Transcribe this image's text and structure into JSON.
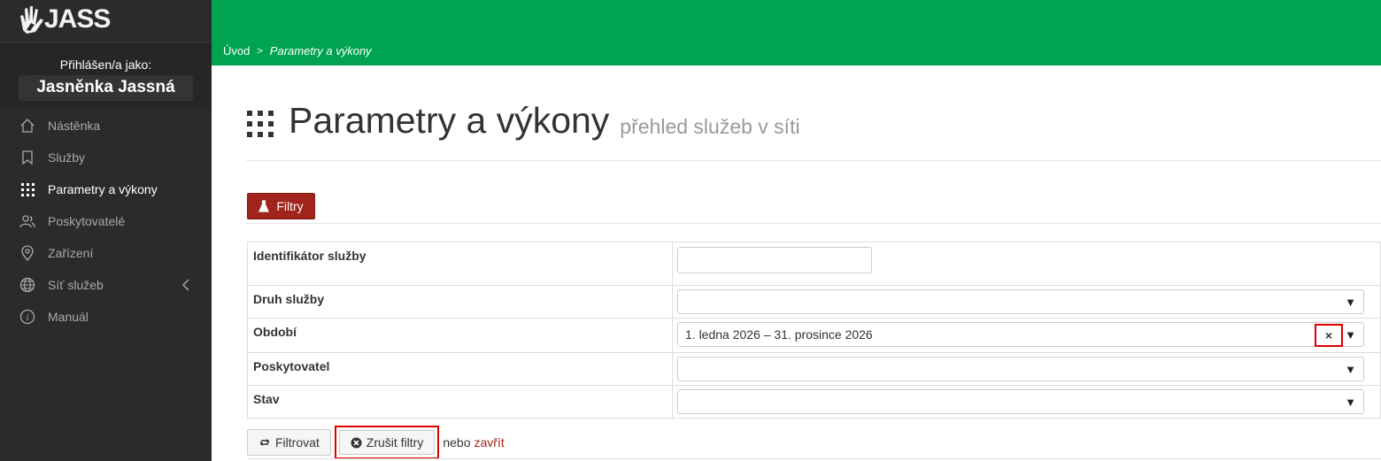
{
  "app": {
    "logo_text": "JASS"
  },
  "user": {
    "label": "Přihlášen/a jako:",
    "name": "Jasněnka Jassná"
  },
  "sidebar": {
    "items": [
      {
        "label": "Nástěnka",
        "icon": "home-icon"
      },
      {
        "label": "Služby",
        "icon": "bookmark-icon"
      },
      {
        "label": "Parametry a výkony",
        "icon": "grid-icon"
      },
      {
        "label": "Poskytovatelé",
        "icon": "users-icon"
      },
      {
        "label": "Zařízení",
        "icon": "map-pin-icon"
      },
      {
        "label": "Síť služeb",
        "icon": "globe-icon"
      },
      {
        "label": "Manuál",
        "icon": "info-icon"
      }
    ]
  },
  "breadcrumb": {
    "home": "Úvod",
    "separator": ">",
    "current": "Parametry a výkony"
  },
  "page": {
    "title": "Parametry a výkony",
    "subtitle": "přehled služeb v síti"
  },
  "filters": {
    "toggle_label": "Filtry",
    "rows": [
      {
        "label": "Identifikátor služby",
        "value": ""
      },
      {
        "label": "Druh služby",
        "value": ""
      },
      {
        "label": "Období",
        "value": "1. ledna 2026 – 31. prosince 2026",
        "clear": "×"
      },
      {
        "label": "Poskytovatel",
        "value": ""
      },
      {
        "label": "Stav",
        "value": ""
      }
    ],
    "apply_label": "Filtrovat",
    "cancel_label": "Zrušit filtry",
    "or_text": "nebo",
    "close_label": "zavřít"
  },
  "colors": {
    "accent_green": "#00a34f",
    "danger_red": "#a0241b",
    "sidebar_bg": "#2b2b2b",
    "highlight_red": "#e00000"
  }
}
